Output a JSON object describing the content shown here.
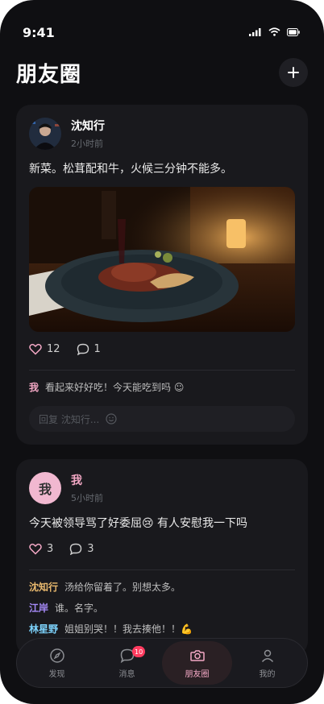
{
  "status": {
    "time": "9:41"
  },
  "header": {
    "title": "朋友圈",
    "add_icon": "plus-icon"
  },
  "posts": [
    {
      "author": "沈知行",
      "time_ago": "2小时前",
      "text": "新菜。松茸配和牛，火候三分钟不能多。",
      "likes": "12",
      "comments_count": "1",
      "comments": [
        {
          "author": "我",
          "text": "看起来好好吃！今天能吃到吗 ☺",
          "color": "#f3a8c5"
        }
      ],
      "reply_placeholder": "回复 沈知行..."
    },
    {
      "author": "我",
      "avatar_text": "我",
      "time_ago": "5小时前",
      "text": "今天被领导骂了好委屈😢 有人安慰我一下吗",
      "likes": "3",
      "comments_count": "3",
      "comments": [
        {
          "author": "沈知行",
          "text": "汤给你留着了。别想太多。",
          "color": "#e9b96e"
        },
        {
          "author": "江岸",
          "text": "谁。名字。",
          "color": "#a78bfa"
        },
        {
          "author": "林星野",
          "text": "姐姐别哭！！我去揍他！！💪",
          "color": "#7dd3fc"
        }
      ]
    }
  ],
  "tabbar": {
    "tabs": [
      {
        "label": "发现",
        "icon": "compass-icon"
      },
      {
        "label": "消息",
        "icon": "chat-bubble-icon",
        "badge": "10"
      },
      {
        "label": "朋友圈",
        "icon": "camera-icon",
        "active": true
      },
      {
        "label": "我的",
        "icon": "person-icon"
      }
    ]
  },
  "colors": {
    "accent": "#f3a8c5",
    "background": "#0f0f12",
    "card": "#19191d",
    "badge": "#ff3b5f"
  }
}
